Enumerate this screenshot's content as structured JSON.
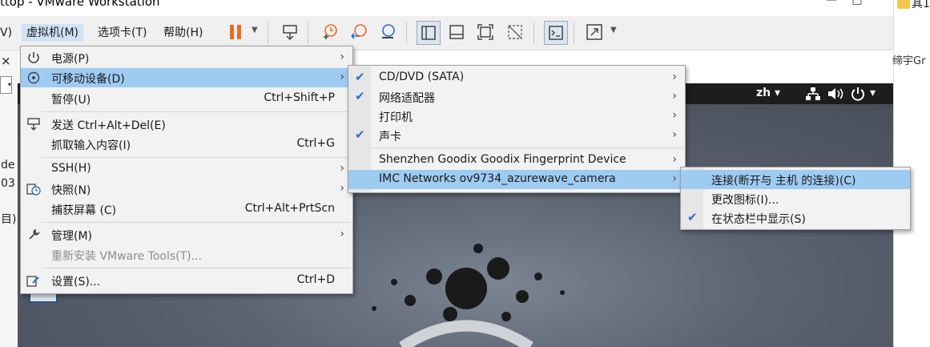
{
  "window": {
    "title": "ttop - VMware Workstation",
    "minimize": "—",
    "maximize": "□"
  },
  "menubar": {
    "partial_view": "V)",
    "vm": "虚拟机(M)",
    "tabs": "选项卡(T)",
    "help": "帮助(H)"
  },
  "left_strip": {
    "close": "×",
    "frag1": "de",
    "frag2": "03",
    "frag3": "目)"
  },
  "right_strip": {
    "top_text": "其1",
    "frag": "缔宇Gr"
  },
  "vm_topbar": {
    "lang": "zh ▾",
    "sys": "▾"
  },
  "main_menu": {
    "items": [
      {
        "label": "电源(P)",
        "icon": "power-icon"
      },
      {
        "label": "可移动设备(D)",
        "icon": "removable-devices-icon"
      },
      {
        "label": "暂停(U)",
        "shortcut": "Ctrl+Shift+P"
      },
      {
        "label": "发送 Ctrl+Alt+Del(E)",
        "icon": "send-keys-icon"
      },
      {
        "label": "抓取输入内容(I)",
        "shortcut": "Ctrl+G"
      },
      {
        "label": "SSH(H)"
      },
      {
        "label": "快照(N)",
        "icon": "snapshot-icon"
      },
      {
        "label": "捕获屏幕 (C)",
        "shortcut": "Ctrl+Alt+PrtScn"
      },
      {
        "label": "管理(M)",
        "icon": "wrench-icon"
      },
      {
        "label": "重新安装 VMware Tools(T)...",
        "disabled": true
      },
      {
        "label": "设置(S)...",
        "icon": "settings-icon",
        "shortcut": "Ctrl+D"
      }
    ]
  },
  "devices_menu": {
    "items": [
      {
        "label": "CD/DVD (SATA)",
        "checked": true
      },
      {
        "label": "网络适配器",
        "checked": true
      },
      {
        "label": "打印机",
        "checked": false
      },
      {
        "label": "声卡",
        "checked": true
      },
      {
        "label": "Shenzhen Goodix Goodix Fingerprint Device",
        "checked": false
      },
      {
        "label": "IMC Networks ov9734_azurewave_camera",
        "checked": false
      }
    ]
  },
  "camera_menu": {
    "items": [
      {
        "label": "连接(断开与 主机 的连接)(C)",
        "checked": false
      },
      {
        "label": "更改图标(I)...",
        "checked": false
      },
      {
        "label": "在状态栏中显示(S)",
        "checked": true
      }
    ]
  },
  "glyphs": {
    "arrow": "›",
    "check": "✔"
  },
  "colors": {
    "highlight": "#9ecbf2",
    "menu_bg": "#f2f2f2",
    "check": "#2a6fc9",
    "pause": "#ee6a1e"
  }
}
